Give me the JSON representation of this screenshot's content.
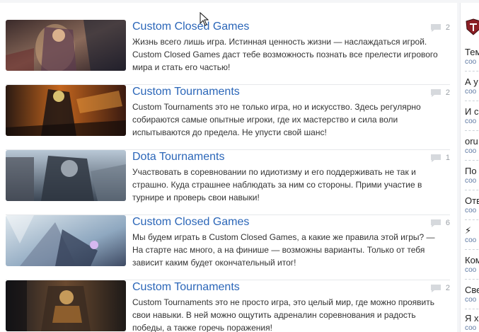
{
  "posts": [
    {
      "title": "Custom Closed Games",
      "description": "Жизнь всего лишь игра. Истинная ценность жизни — наслаждаться игрой. Custom Closed Games даст тебе возможность познать все прелести игрового мира и стать его частью!",
      "comments": "2"
    },
    {
      "title": "Custom Tournaments",
      "description": "Custom Tournaments это не только игра, но и искусство. Здесь регулярно собираются самые опытные игроки, где их мастерство и сила воли испытываются до предела. Не упусти свой шанс!",
      "comments": "2"
    },
    {
      "title": "Dota Tournaments",
      "description": "Участвовать в соревновании по идиотизму и его поддерживать не так и страшно. Куда страшнее наблюдать за ним со стороны. Прими участие в турнире и проверь свои навыки!",
      "comments": "1"
    },
    {
      "title": "Custom Closed Games",
      "description": "Мы будем играть в Custom Closed Games, а какие же правила этой игры? — На старте нас много, а на финише — возможны варианты. Только от тебя зависит каким будет окончательный итог!",
      "comments": "6"
    },
    {
      "title": "Custom Tournaments",
      "description": "Custom Tournaments это не просто игра, это целый мир, где можно проявить свои навыки. В ней можно ощутить адреналин соревнования и радость победы, а также горечь поражения!",
      "comments": "2"
    }
  ],
  "sidebar": {
    "items": [
      {
        "title": "Тем",
        "sub": "соо"
      },
      {
        "title": "А у",
        "sub": "соо"
      },
      {
        "title": "И с",
        "sub": "соо"
      },
      {
        "title": "oru",
        "sub": "соо"
      },
      {
        "title": "По",
        "sub": "соо"
      },
      {
        "title": "Отв",
        "sub": "соо"
      },
      {
        "title": "⚡",
        "sub": "соо"
      },
      {
        "title": "Ком",
        "sub": "соо"
      },
      {
        "title": "Све",
        "sub": "соо"
      },
      {
        "title": "Я хо",
        "sub": "соо"
      }
    ]
  },
  "icons": {
    "comment": "comment-bubble-icon",
    "cursor": "mouse-pointer-icon",
    "logo": "site-logo-icon"
  },
  "colors": {
    "link": "#2b66b8",
    "muted": "#9aa0a6",
    "sidebar_link": "#5f7aa3"
  }
}
